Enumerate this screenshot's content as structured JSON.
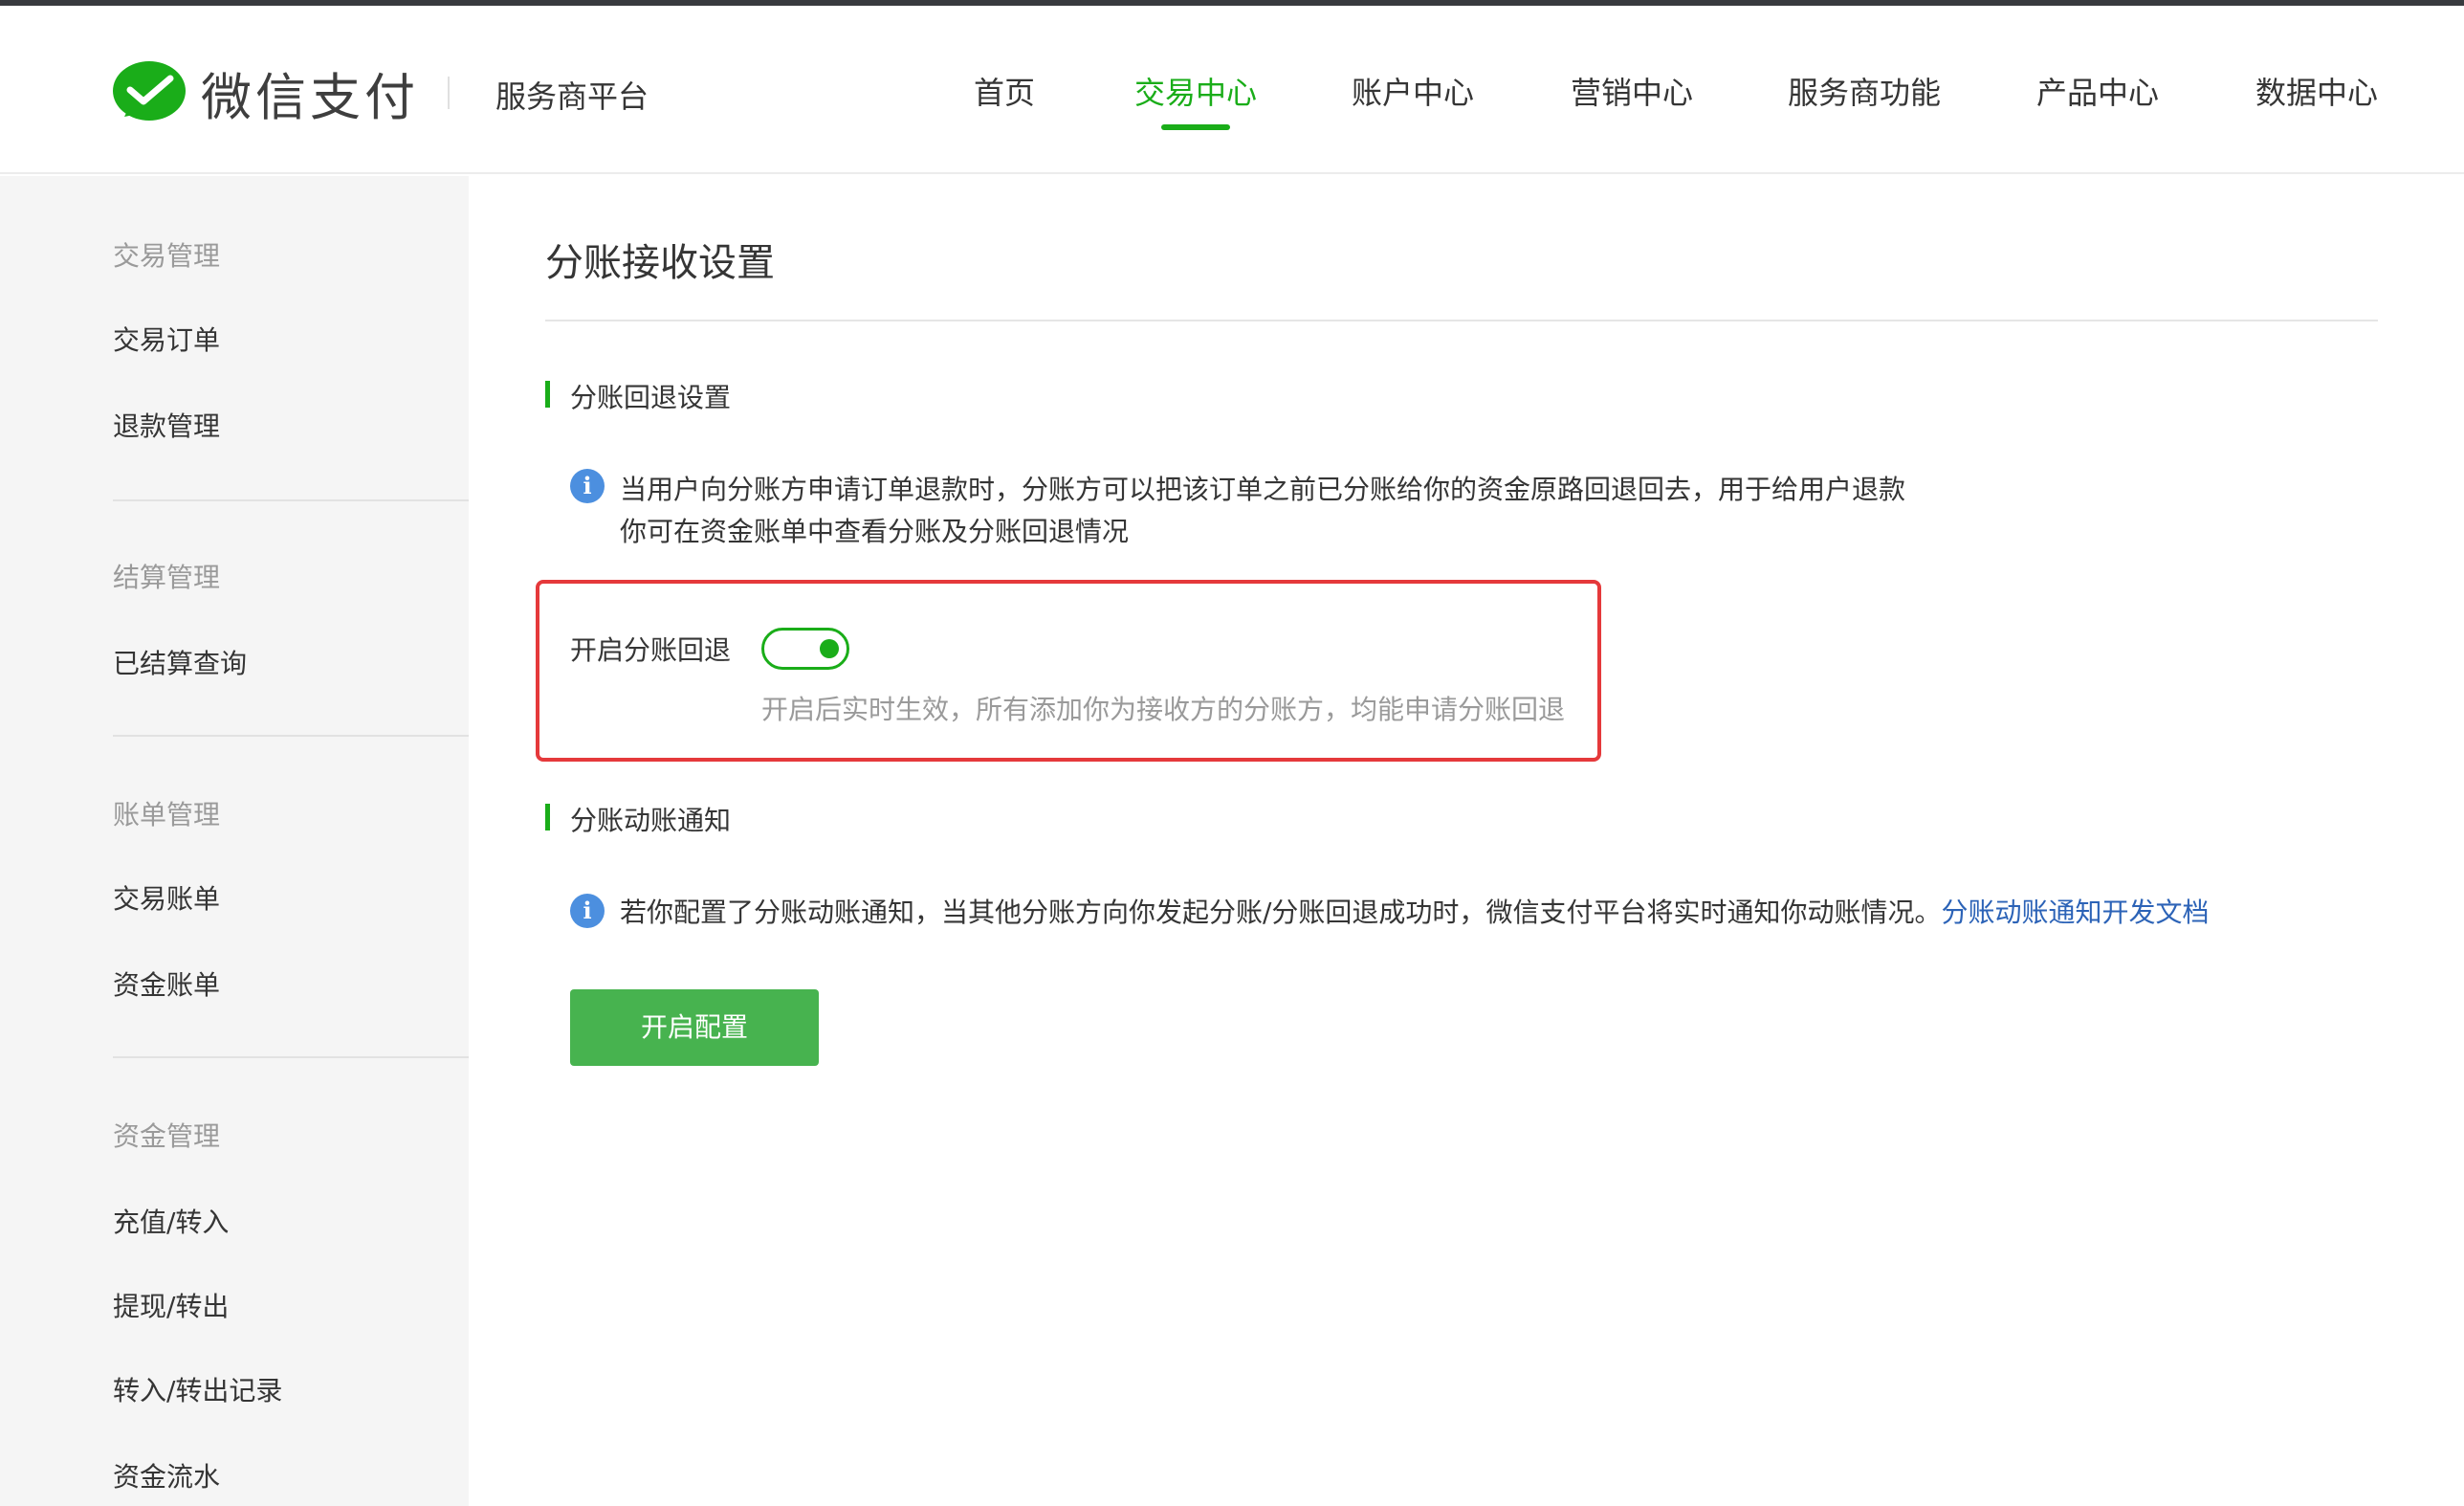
{
  "header": {
    "logo_text": "微信支付",
    "platform": "服务商平台",
    "nav": [
      "首页",
      "交易中心",
      "账户中心",
      "营销中心",
      "服务商功能",
      "产品中心",
      "数据中心"
    ],
    "active_nav": "交易中心",
    "accent_color": "#1aad19"
  },
  "sidebar": {
    "groups": [
      {
        "heading": "交易管理",
        "items": [
          "交易订单",
          "退款管理"
        ]
      },
      {
        "heading": "结算管理",
        "items": [
          "已结算查询"
        ]
      },
      {
        "heading": "账单管理",
        "items": [
          "交易账单",
          "资金账单"
        ]
      },
      {
        "heading": "资金管理",
        "items": [
          "充值/转入",
          "提现/转出",
          "转入/转出记录",
          "资金流水"
        ]
      }
    ]
  },
  "main": {
    "title": "分账接收设置",
    "refund_section": {
      "title": "分账回退设置",
      "info_line1": "当用户向分账方申请订单退款时，分账方可以把该订单之前已分账给你的资金原路回退回去，用于给用户退款",
      "info_line2": "你可在资金账单中查看分账及分账回退情况",
      "toggle_label": "开启分账回退",
      "toggle_on": true,
      "toggle_hint": "开启后实时生效，所有添加你为接收方的分账方，均能申请分账回退"
    },
    "notify_section": {
      "title": "分账动账通知",
      "info_text": "若你配置了分账动账通知，当其他分账方向你发起分账/分账回退成功时，微信支付平台将实时通知你动账情况。",
      "doc_link": "分账动账通知开发文档",
      "button": "开启配置"
    }
  }
}
